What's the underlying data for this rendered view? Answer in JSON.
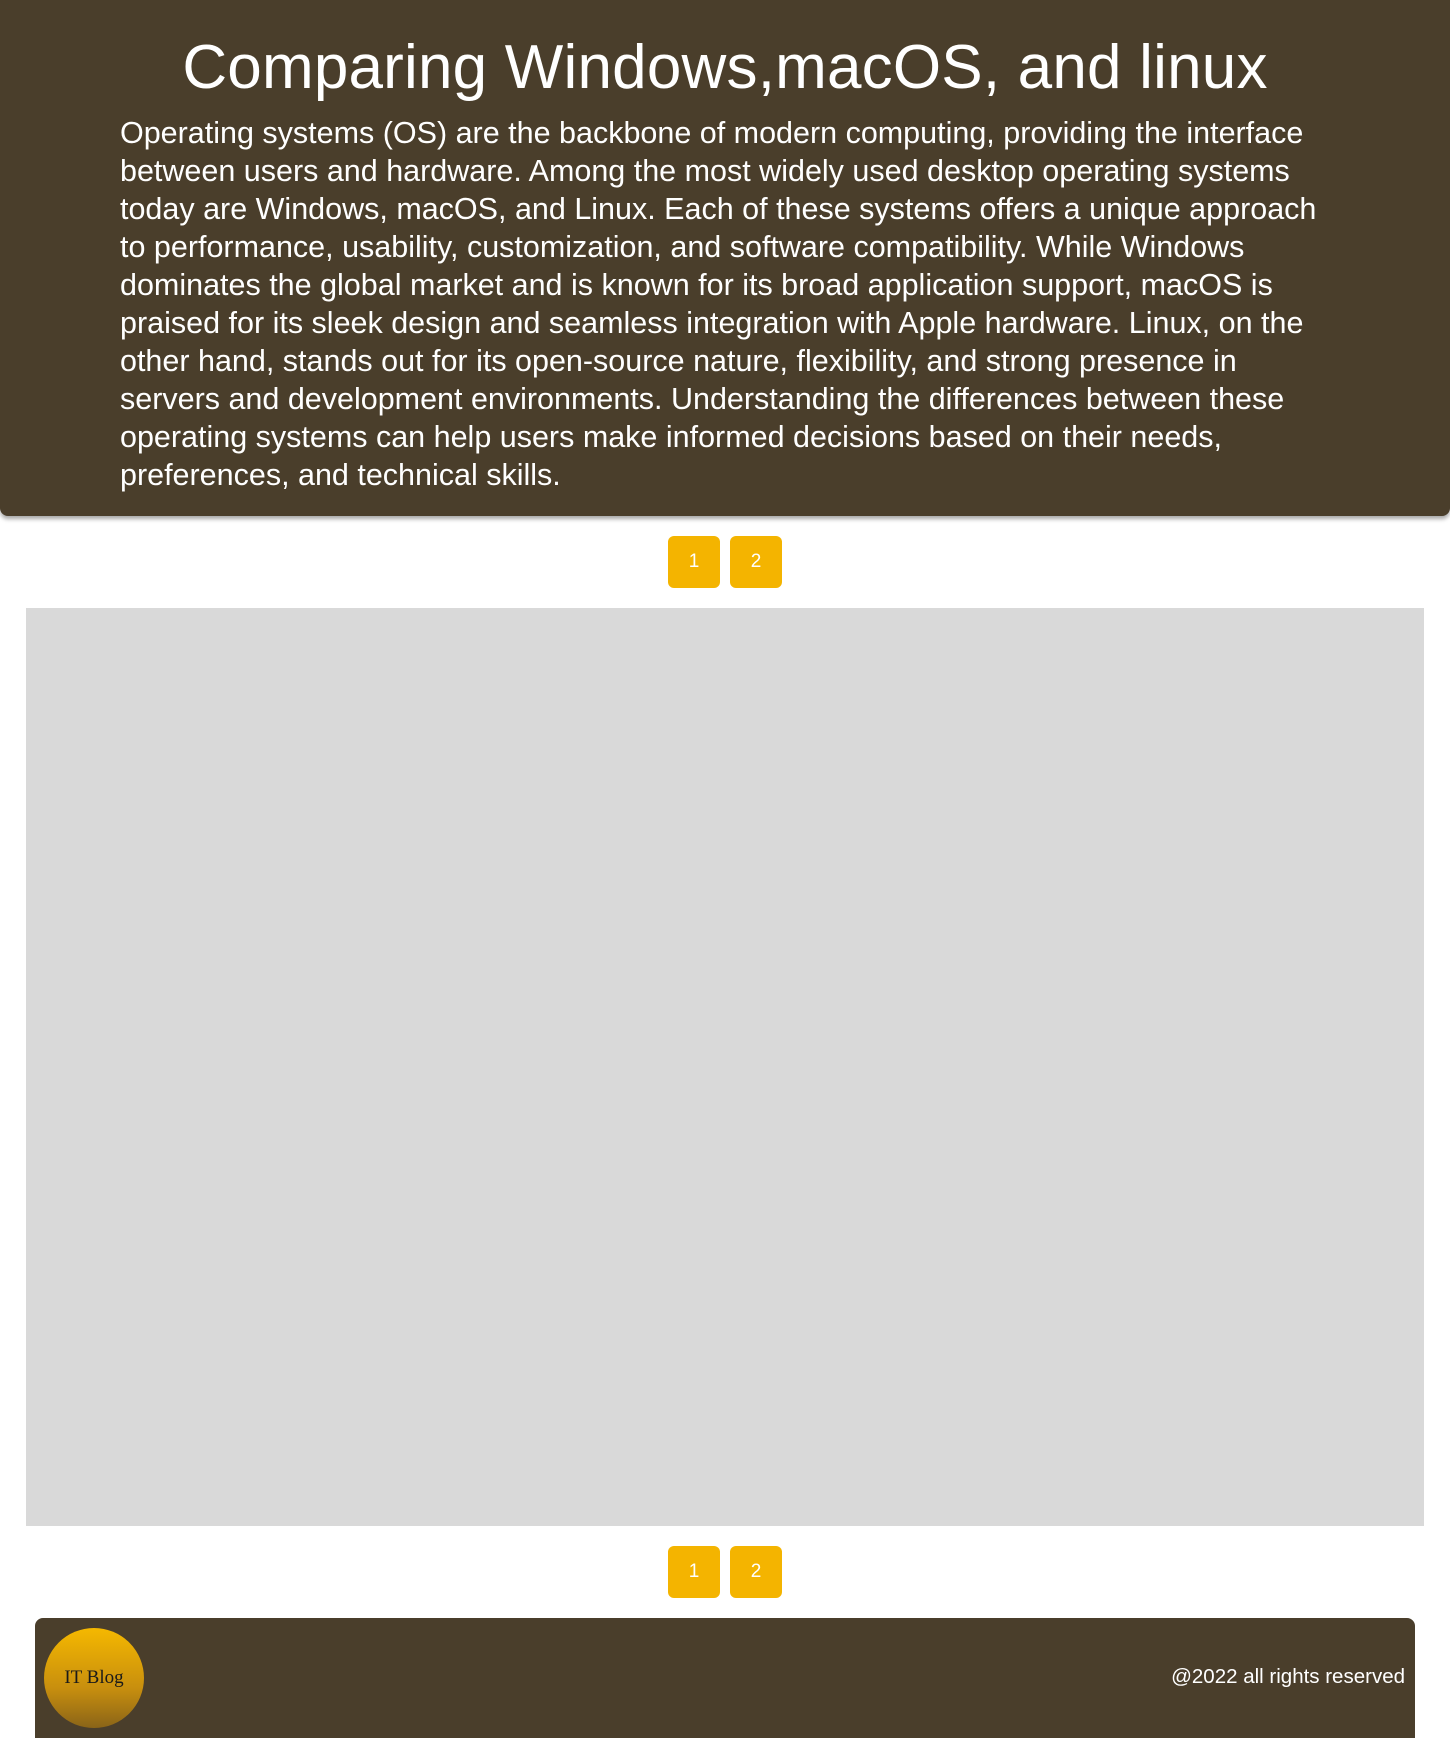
{
  "header": {
    "title": "Comparing Windows,macOS, and linux",
    "intro": "Operating systems (OS) are the backbone of modern computing, providing the interface between users and hardware. Among the most widely used desktop operating systems today are Windows, macOS, and Linux. Each of these systems offers a unique approach to performance, usability, customization, and software compatibility. While Windows dominates the global market and is known for its broad application support, macOS is praised for its sleek design and seamless integration with Apple hardware. Linux, on the other hand, stands out for its open-source nature, flexibility, and strong presence in servers and development environments. Understanding the differences between these operating systems can help users make informed decisions based on their needs, preferences, and technical skills."
  },
  "pagination_top": {
    "pages": [
      "1",
      "2"
    ]
  },
  "pagination_bottom": {
    "pages": [
      "1",
      "2"
    ]
  },
  "footer": {
    "logo_text": "IT Blog",
    "copyright": "@2022 all rights reserved"
  },
  "colors": {
    "header_background": "#4a3e2b",
    "page_button": "#f4b400",
    "content_placeholder": "#d9d9d9"
  }
}
